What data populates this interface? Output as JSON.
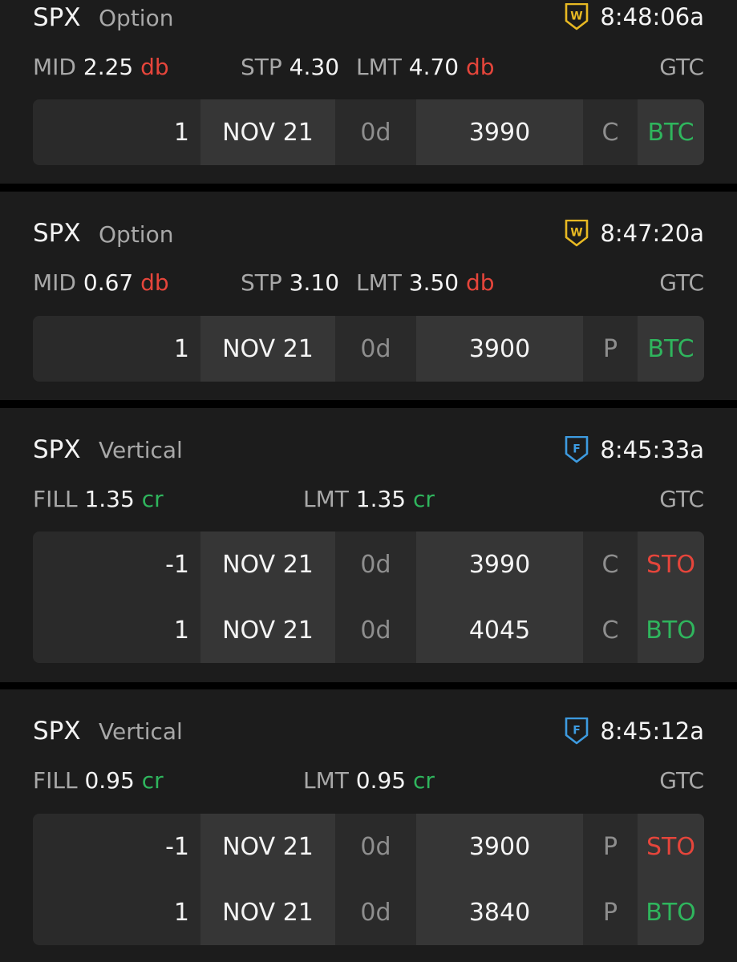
{
  "colors": {
    "background": "#000000",
    "card": "#1c1c1c",
    "debit": "#e5453b",
    "credit": "#2fb55d",
    "badge_working": "#e8b923",
    "badge_filled": "#3d9be0"
  },
  "orders": [
    {
      "symbol": "SPX",
      "type": "Option",
      "status_icon": "working-badge-icon",
      "status_letter": "W",
      "time": "8:48:06a",
      "price_label": "MID",
      "price_value": "2.25",
      "price_unit": "db",
      "stop_label": "STP",
      "stop_value": "4.30",
      "limit_label": "LMT",
      "limit_value": "4.70",
      "limit_unit": "db",
      "tif": "GTC",
      "legs": [
        {
          "qty": "1",
          "exp": "NOV 21",
          "dte": "0d",
          "strike": "3990",
          "pc": "C",
          "side": "BTC"
        }
      ]
    },
    {
      "symbol": "SPX",
      "type": "Option",
      "status_icon": "working-badge-icon",
      "status_letter": "W",
      "time": "8:47:20a",
      "price_label": "MID",
      "price_value": "0.67",
      "price_unit": "db",
      "stop_label": "STP",
      "stop_value": "3.10",
      "limit_label": "LMT",
      "limit_value": "3.50",
      "limit_unit": "db",
      "tif": "GTC",
      "legs": [
        {
          "qty": "1",
          "exp": "NOV 21",
          "dte": "0d",
          "strike": "3900",
          "pc": "P",
          "side": "BTC"
        }
      ]
    },
    {
      "symbol": "SPX",
      "type": "Vertical",
      "status_icon": "filled-badge-icon",
      "status_letter": "F",
      "time": "8:45:33a",
      "price_label": "FILL",
      "price_value": "1.35",
      "price_unit": "cr",
      "limit_label": "LMT",
      "limit_value": "1.35",
      "limit_unit": "cr",
      "tif": "GTC",
      "legs": [
        {
          "qty": "-1",
          "exp": "NOV 21",
          "dte": "0d",
          "strike": "3990",
          "pc": "C",
          "side": "STO"
        },
        {
          "qty": "1",
          "exp": "NOV 21",
          "dte": "0d",
          "strike": "4045",
          "pc": "C",
          "side": "BTO"
        }
      ]
    },
    {
      "symbol": "SPX",
      "type": "Vertical",
      "status_icon": "filled-badge-icon",
      "status_letter": "F",
      "time": "8:45:12a",
      "price_label": "FILL",
      "price_value": "0.95",
      "price_unit": "cr",
      "limit_label": "LMT",
      "limit_value": "0.95",
      "limit_unit": "cr",
      "tif": "GTC",
      "legs": [
        {
          "qty": "-1",
          "exp": "NOV 21",
          "dte": "0d",
          "strike": "3900",
          "pc": "P",
          "side": "STO"
        },
        {
          "qty": "1",
          "exp": "NOV 21",
          "dte": "0d",
          "strike": "3840",
          "pc": "P",
          "side": "BTO"
        }
      ]
    }
  ]
}
